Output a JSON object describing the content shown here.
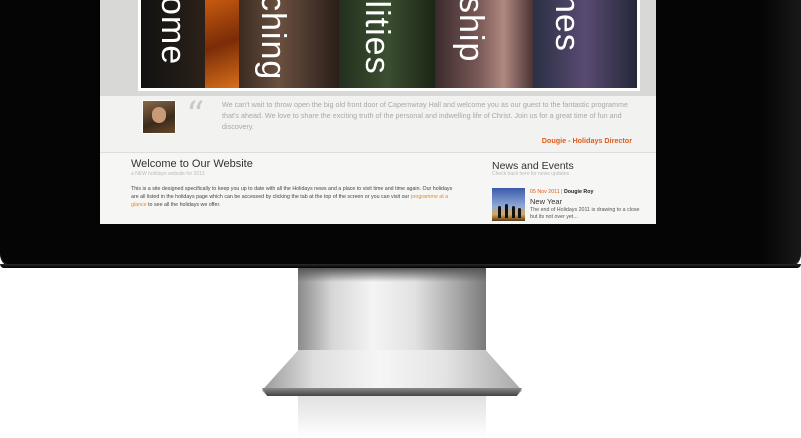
{
  "banner": {
    "words": [
      "ome",
      "ching",
      "ilities",
      "ship",
      "nes"
    ]
  },
  "quote": {
    "text": "We can't wait to throw open the big old front door of Capernwray Hall and welcome you as our guest to the fantastic programme that's ahead. We love to share the exciting truth of the personal and indwelling life of Christ. Join us for a great time of fun and discovery.",
    "author": "Dougie - Holidays Director"
  },
  "welcome": {
    "title": "Welcome to Our Website",
    "subtitle": "a NEW holidays website for 2012",
    "body_start": "This is a site designed specifically to keep you up to date with all the Holidays news and a place to visit time and time again. Our holidays are all listed in the holidays page which can be accessed by clicking the tab at the top of the screen or you can visit our ",
    "link": "programme at a glance",
    "body_end": " to see all the holidays we offer."
  },
  "news": {
    "title": "News and Events",
    "subtitle": "Check back here for news updates",
    "item": {
      "date": "05 Nov 2011",
      "author": "Dougie Roy",
      "headline": "New Year",
      "excerpt": "The end of Holidays 2011 is drawing to a close but its not over yet..."
    }
  }
}
